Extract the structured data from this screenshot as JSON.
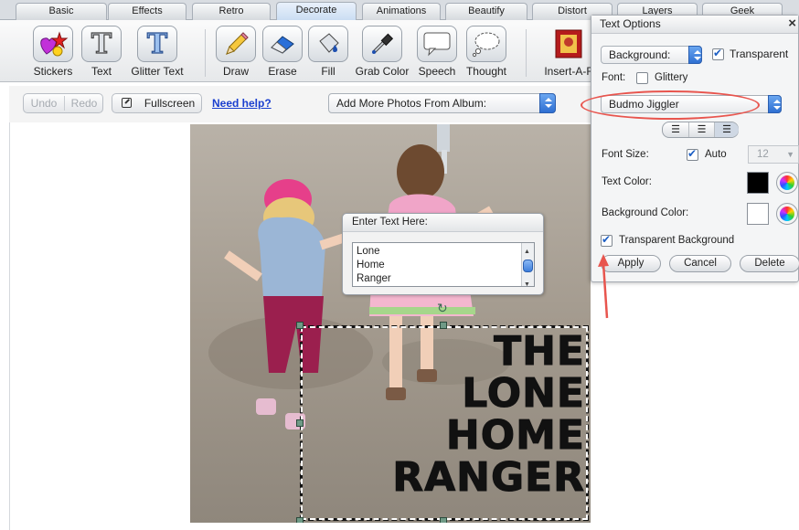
{
  "tabs": [
    "Basic",
    "Effects",
    "Retro",
    "Decorate",
    "Animations",
    "Beautify",
    "Distort",
    "Layers",
    "Geek"
  ],
  "active_tab": "Decorate",
  "tools": {
    "stickers": "Stickers",
    "text": "Text",
    "glitter_text": "Glitter Text",
    "draw": "Draw",
    "erase": "Erase",
    "fill": "Fill",
    "grab_color": "Grab Color",
    "speech": "Speech",
    "thought": "Thought",
    "insert": "Insert-A-F"
  },
  "subbar": {
    "undo": "Undo",
    "redo": "Redo",
    "fullscreen": "Fullscreen",
    "help": "Need help?",
    "album_select": "Add More Photos From Album:"
  },
  "enter_text": {
    "title": "Enter Text Here:",
    "lines": [
      "Lone",
      "Home",
      "Ranger"
    ]
  },
  "overlay_text": [
    "THE",
    "LONE",
    "HOME",
    "RANGER"
  ],
  "text_options": {
    "title": "Text Options",
    "close": "×",
    "background_select": "Background:",
    "transparent_label": "Transparent",
    "transparent_checked": true,
    "font_label": "Font:",
    "glittery_label": "Glittery",
    "glittery_checked": false,
    "font_select": "Budmo Jiggler",
    "font_size_label": "Font Size:",
    "auto_label": "Auto",
    "auto_checked": true,
    "font_size_value": "12",
    "text_color_label": "Text Color:",
    "text_color": "#000000",
    "bg_color_label": "Background Color:",
    "bg_color": "#ffffff",
    "transparent_bg_label": "Transparent Background",
    "transparent_bg_checked": true,
    "apply": "Apply",
    "cancel": "Cancel",
    "delete": "Delete"
  },
  "colors": {
    "accent": "#2e6fd2",
    "highlight_ring": "#e8554e",
    "link": "#1a3fcf"
  }
}
